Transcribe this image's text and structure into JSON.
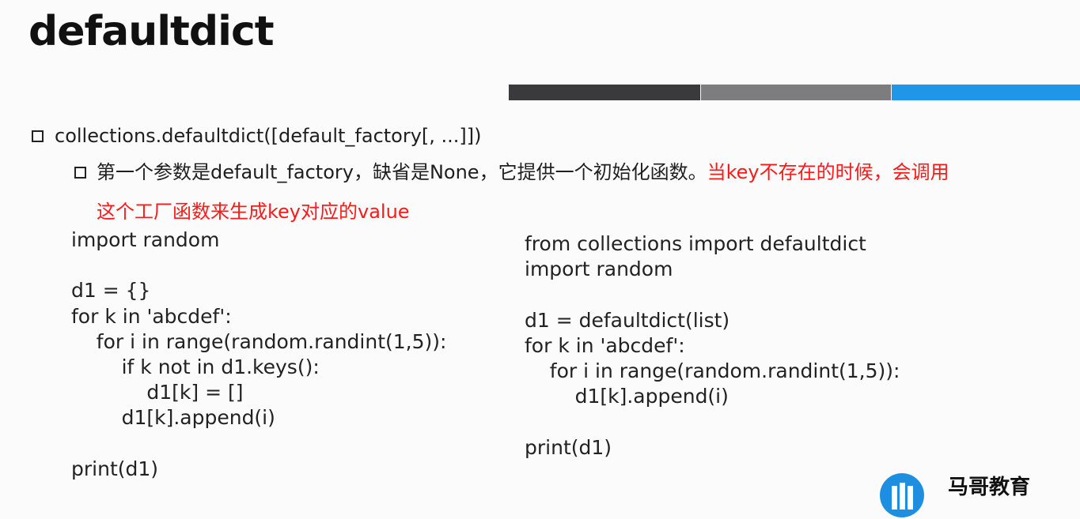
{
  "slide": {
    "title": "defaultdict",
    "bullet1": "collections.defaultdict([default_factory[, ...]])",
    "bullet2_plain": "第一个参数是default_factory，缺省是None，它提供一个初始化函数。",
    "bullet2_red_a": "当key不存在的时候，会调用",
    "bullet2_red_b": "这个工厂函数来生成key对应的value",
    "colors": {
      "bar_dark": "#3a3a3c",
      "bar_gray": "#7d7d7f",
      "bar_blue": "#2196e6",
      "highlight": "#ff1a1a"
    }
  },
  "code_left": [
    "import random",
    "",
    "d1 = {}",
    "for k in 'abcdef':",
    "    for i in range(random.randint(1,5)):",
    "        if k not in d1.keys():",
    "            d1[k] = []",
    "        d1[k].append(i)",
    "",
    "print(d1)"
  ],
  "code_right": [
    "from collections import defaultdict",
    "import random",
    "",
    "d1 = defaultdict(list)",
    "for k in 'abcdef':",
    "    for i in range(random.randint(1,5)):",
    "        d1[k].append(i)",
    "",
    "print(d1)"
  ],
  "brand": {
    "name": "马哥教育",
    "logo_icon": "brand-logo-icon"
  }
}
